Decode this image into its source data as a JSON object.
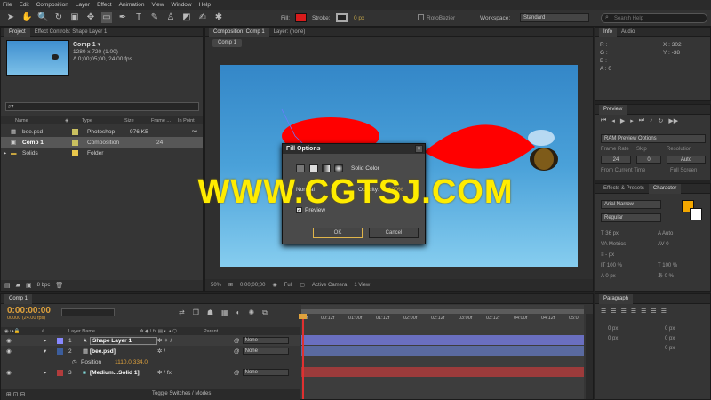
{
  "menu": [
    "File",
    "Edit",
    "Composition",
    "Layer",
    "Effect",
    "Animation",
    "View",
    "Window",
    "Help"
  ],
  "toolbar": {
    "fill_label": "Fill:",
    "stroke_label": "Stroke:",
    "stroke_px": "0 px",
    "rotobezier_label": "RotoBezier",
    "workspace_label": "Workspace:",
    "workspace_value": "Standard",
    "search_placeholder": "Search Help",
    "fill_color": "#d81b1b"
  },
  "project": {
    "tabs": [
      "Project",
      "Effect Controls: Shape Layer 1"
    ],
    "comp_name": "Comp 1 ▾",
    "comp_size": "1280 x 720 (1.00)",
    "comp_duration": "Δ 0;00;05;00, 24.00 fps",
    "search_value": "",
    "columns": {
      "name": "Name",
      "type": "Type",
      "size": "Size",
      "frame": "Frame ...",
      "inpoint": "In Point"
    },
    "items": [
      {
        "name": "bee.psd",
        "type": "Photoshop",
        "size": "976 KB",
        "frame": "",
        "color": "#c9c060"
      },
      {
        "name": "Comp 1",
        "type": "Composition",
        "size": "",
        "frame": "24",
        "color": "#c9c060"
      },
      {
        "name": "Solids",
        "type": "Folder",
        "size": "",
        "frame": "",
        "color": "#e8c74c"
      }
    ],
    "bpc": "8 bpc"
  },
  "composition": {
    "tabs": [
      "Composition: Comp 1",
      "Layer: (none)"
    ],
    "breadcrumb": "Comp 1",
    "zoom": "50%",
    "timecode": "0;00;00;00",
    "res": "Full",
    "camera": "Active Camera",
    "views": "1 View"
  },
  "dialog": {
    "title": "Fill Options",
    "fill_type": "Solid Color",
    "mode_label": "Normal",
    "opacity_label": "Opacity:",
    "opacity_value": "100%",
    "preview_label": "Preview",
    "ok": "OK",
    "cancel": "Cancel"
  },
  "watermark": "WWW.CGTSJ.COM",
  "info": {
    "tabs": [
      "Info",
      "Audio"
    ],
    "r": "R :",
    "g": "G :",
    "b": "B :",
    "a": "A : 0",
    "x": "X : 302",
    "y": "Y : -38"
  },
  "preview": {
    "tab": "Preview",
    "ram_label": "RAM Preview Options",
    "frame_rate": "Frame Rate",
    "skip": "Skip",
    "resolution": "Resolution",
    "fr_value": "24",
    "skip_value": "0",
    "res_value": "Auto",
    "from_current": "From Current Time",
    "full_screen": "Full Screen"
  },
  "character": {
    "tabs": [
      "Effects & Presets",
      "Character"
    ],
    "font": "Arial Narrow",
    "style": "Regular",
    "size": "36 px",
    "leading": "Auto",
    "kerning": "Metrics",
    "tracking": "0",
    "stroke_px": "- px",
    "scale_v": "100 %",
    "scale_h": "100 %",
    "baseline": "0 px",
    "tsume": "0 %",
    "fill": "#f3a700"
  },
  "paragraph": {
    "tab": "Paragraph",
    "vals": [
      "0 px",
      "0 px",
      "0 px",
      "0 px",
      "0 px"
    ]
  },
  "timeline": {
    "tab": "Comp 1",
    "timecode": "0:00:00:00",
    "fps": "00000 (24.00 fps)",
    "columns": {
      "num": "#",
      "layer": "Layer Name",
      "parent": "Parent"
    },
    "ruler": [
      "0f",
      "00:12f",
      "01:00f",
      "01:12f",
      "02:00f",
      "02:12f",
      "03:00f",
      "03:12f",
      "04:00f",
      "04:12f",
      "05:0"
    ],
    "layers": [
      {
        "num": "1",
        "name": "Shape Layer 1",
        "parent": "None",
        "color": "#8888ff",
        "bar": "#6a6fc0"
      },
      {
        "num": "2",
        "name": "[bee.psd]",
        "parent": "None",
        "color": "#3c5d9c",
        "bar": "#5a6aa0"
      },
      {
        "num": "3",
        "name": "[Medium...Solid 1]",
        "parent": "None",
        "color": "#b23c3c",
        "bar": "#9c3b3b"
      }
    ],
    "position_label": "Position",
    "position_value": "1110.0,334.0",
    "toggle": "Toggle Switches / Modes"
  }
}
